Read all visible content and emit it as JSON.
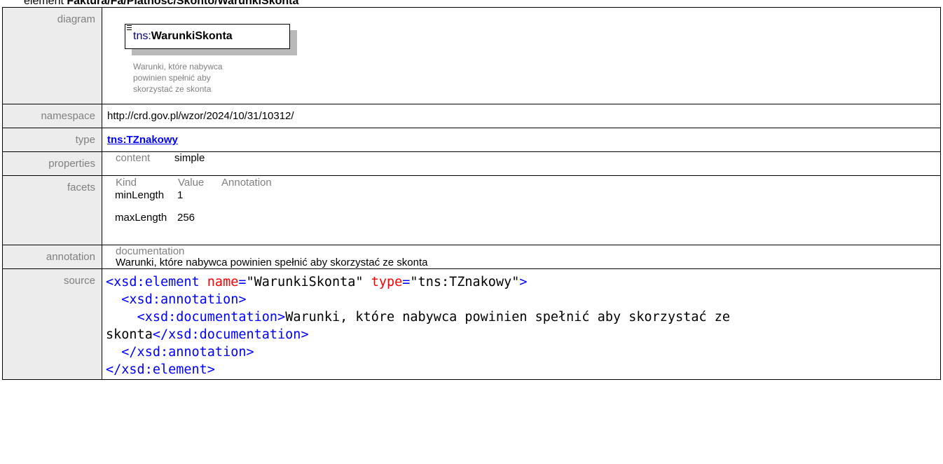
{
  "heading": {
    "prefix": "element ",
    "path": "Faktura/Fa/Platnosc/Skonto/WarunkiSkonta"
  },
  "labels": {
    "diagram": "diagram",
    "namespace": "namespace",
    "type": "type",
    "properties": "properties",
    "facets": "facets",
    "annotation": "annotation",
    "source": "source"
  },
  "diagram": {
    "prefix": "tns:",
    "name": "WarunkiSkonta",
    "doc_line1": "Warunki, które nabywca",
    "doc_line2": "powinien spełnić aby",
    "doc_line3": "skorzystać ze skonta",
    "icon": "element-icon"
  },
  "namespace": "http://crd.gov.pl/wzor/2024/10/31/10312/",
  "type": "tns:TZnakowy",
  "properties": {
    "key": "content",
    "value": "simple"
  },
  "facets": {
    "headers": [
      "Kind",
      "Value",
      "Annotation"
    ],
    "rows": [
      {
        "kind": "minLength",
        "value": "1"
      },
      {
        "kind": "maxLength",
        "value": "256"
      }
    ]
  },
  "annotation": {
    "label": "documentation",
    "text": "Warunki, które nabywca powinien spełnić aby skorzystać ze skonta"
  },
  "source": {
    "l1_open": "<xsd:element ",
    "l1_attr1": "name",
    "l1_eq1": "=",
    "l1_val1": "\"WarunkiSkonta\"",
    "l1_attr2": "type",
    "l1_eq2": "=",
    "l1_val2": "\"tns:TZnakowy\"",
    "l1_close": ">",
    "l2": "<xsd:annotation>",
    "l3_open": "<xsd:documentation>",
    "l3_text": "Warunki, które nabywca powinien spełnić aby skorzystać ze skonta",
    "l3_close": "</xsd:documentation>",
    "l4": "</xsd:annotation>",
    "l5": "</xsd:element>"
  },
  "colors": {
    "label_bg": "#ececec",
    "label_text": "#808080",
    "link": "#0000ff",
    "xml_tag": "#0000ff",
    "xml_attr": "#ff0000"
  }
}
